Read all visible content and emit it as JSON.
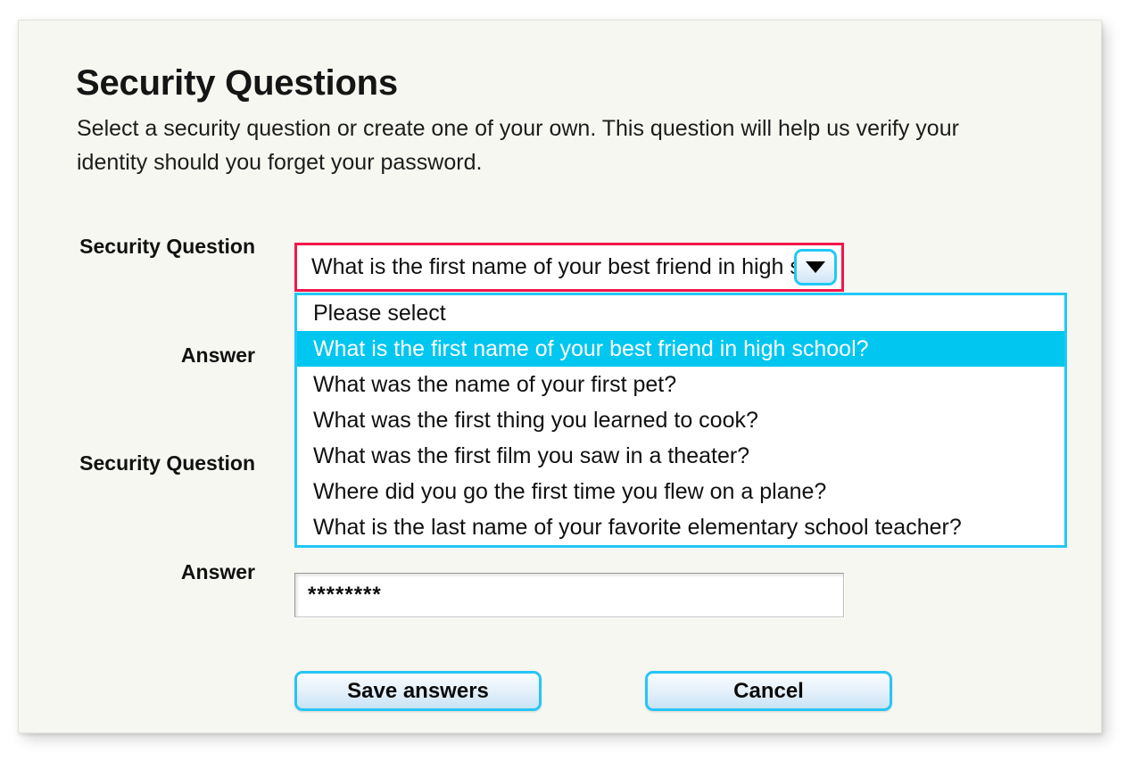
{
  "panel": {
    "title": "Security Questions",
    "description": "Select a security question or create one of your own. This question will help us verify your identity should you forget your password."
  },
  "form": {
    "labels": {
      "security_question_1": "Security Question",
      "answer_1": "Answer",
      "security_question_2": "Security Question",
      "answer_2": "Answer"
    },
    "security_question_select": {
      "selected_value": "What is the first name of your best friend in high s",
      "expanded": true,
      "dropdown_icon": "chevron-down-icon",
      "options": [
        {
          "label": "Please select",
          "selected": false
        },
        {
          "label": "What is the first name of your best friend in high school?",
          "selected": true
        },
        {
          "label": "What was the name of your first pet?",
          "selected": false
        },
        {
          "label": "What was the first thing you learned to cook?",
          "selected": false
        },
        {
          "label": "What was the first film you saw in a theater?",
          "selected": false
        },
        {
          "label": "Where did you go the first time you flew on a plane?",
          "selected": false
        },
        {
          "label": "What is the last name of your favorite elementary school teacher?",
          "selected": false
        }
      ]
    },
    "answer_input": {
      "value": "********",
      "placeholder": ""
    }
  },
  "buttons": {
    "save": "Save answers",
    "cancel": "Cancel"
  },
  "colors": {
    "panel_background": "#f7f7f2",
    "page_background": "#ffffff",
    "accent_cyan": "#22c8f6",
    "highlight_cyan": "#00c6f0",
    "error_red": "#f0174c",
    "text": "#111111"
  }
}
